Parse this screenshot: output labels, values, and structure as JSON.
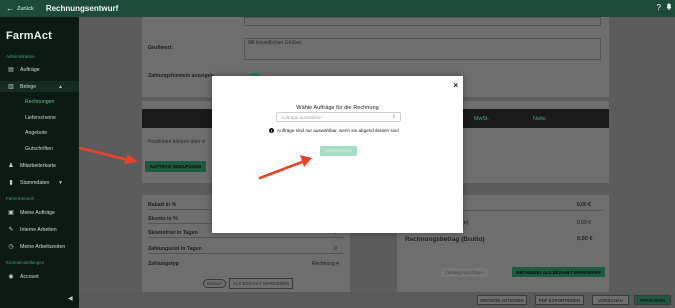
{
  "header": {
    "back_label": "Zurück",
    "title": "Rechnungsentwurf",
    "help_icon": "?",
    "bell_icon": "bell-icon"
  },
  "sidebar": {
    "brand": "FarmAct",
    "section_admin": "Administration",
    "auftraege": "Aufträge",
    "belege": "Belege",
    "sub_rechnungen": "Rechnungen",
    "sub_lieferscheine": "Lieferscheine",
    "sub_angebote": "Angebote",
    "sub_gutschriften": "Gutschriften",
    "mitarbeiterkarte": "Mitarbeiterkarte",
    "stammdaten": "Stammdaten",
    "section_fahrer": "Fahrerbereich",
    "meine_auftraege": "Meine Aufträge",
    "interne_arbeiten": "Interne Arbeiten",
    "meine_arbeitszeiten": "Meine Arbeitszeiten",
    "section_konto": "Kontoeinstellungen",
    "account": "Account"
  },
  "main": {
    "grusswort_label": "Grußwort:",
    "grusswort_value": "Mit freundlichen Grüßen",
    "zahlungshinweis_label": "Zahlungshinweis anzeigen",
    "positions_hint": "Positionen können über d",
    "table_col_mwst": "MwSt.",
    "table_col_netto": "Netto",
    "add_order_button": "AUFTRAG HINZUFÜGEN",
    "rabatt_label": "Rabatt in %",
    "rabatt_value": "0",
    "skonto_label": "Skonto in %",
    "skonto_value": "0",
    "skontofrist_label": "Skontofrist in Tagen",
    "skontofrist_value": "0",
    "zahlungsziel_label": "Zahlungsziel in Tagen",
    "zahlungsziel_value": "0",
    "zahlungstyp_label": "Zahlungstyp",
    "zahlungstyp_value": "Rechnung",
    "entwurf_badge": "Entwurf",
    "bezahlt_button": "ALS BEZAHLT MARKIEREN",
    "summary_value_1": "0,00 €",
    "summary_label_2": "(o)",
    "summary_value_2": "0,00 €",
    "summary_label_total": "Rechnungsbetrag (Brutto)",
    "summary_value_total": "0,00 €",
    "zahlung_button": "Zahlung hinzufügen",
    "rechnung_bezahlt_button": "RECHNUNG ALS BEZAHLT MARKIEREN"
  },
  "bottom": {
    "weitere_aktionen": "WEITERE AKTIONEN",
    "pdf_exportieren": "PDF EXPORTIEREN",
    "vorschau": "VORSCHAU",
    "speichern": "SPEICHERN"
  },
  "modal": {
    "title": "Wähle Aufträge für die Rechnung",
    "select_placeholder": "Aufträge auswählen",
    "hint": "Aufträge sind nur auswählbar, wenn sie abgeschlossen sind",
    "confirm_button": "HINZUFÜGEN",
    "close": "×"
  },
  "colors": {
    "sidebar_bg": "#0d1a14",
    "topbar_bg": "#1c4b3a",
    "accent": "#5fc08c",
    "arrow": "#e8432a"
  }
}
